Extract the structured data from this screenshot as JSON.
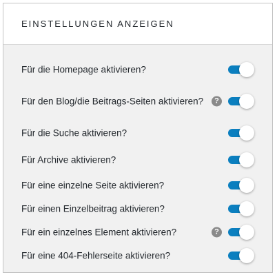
{
  "panel": {
    "title": "EINSTELLUNGEN ANZEIGEN"
  },
  "colors": {
    "toggle_on": "#0b7fbf",
    "background": "#f1f1f1",
    "help_icon": "#8a8a8a"
  },
  "settings": [
    {
      "label": "Für die Homepage aktivieren?",
      "enabled": true,
      "help": false
    },
    {
      "label": "Für den Blog/die Beitrags-Seiten aktivieren?",
      "enabled": true,
      "help": true,
      "help_icon": "help-icon",
      "help_glyph": "?"
    },
    {
      "label": "Für die Suche aktivieren?",
      "enabled": true,
      "help": false
    },
    {
      "label": "Für Archive aktivieren?",
      "enabled": true,
      "help": false
    },
    {
      "label": "Für eine einzelne Seite aktivieren?",
      "enabled": true,
      "help": false
    },
    {
      "label": "Für einen Einzelbeitrag aktivieren?",
      "enabled": true,
      "help": false
    },
    {
      "label": "Für ein einzelnes Element aktivieren?",
      "enabled": true,
      "help": true,
      "help_icon": "help-icon",
      "help_glyph": "?"
    },
    {
      "label": "Für eine 404-Fehlerseite aktivieren?",
      "enabled": true,
      "help": false
    }
  ]
}
